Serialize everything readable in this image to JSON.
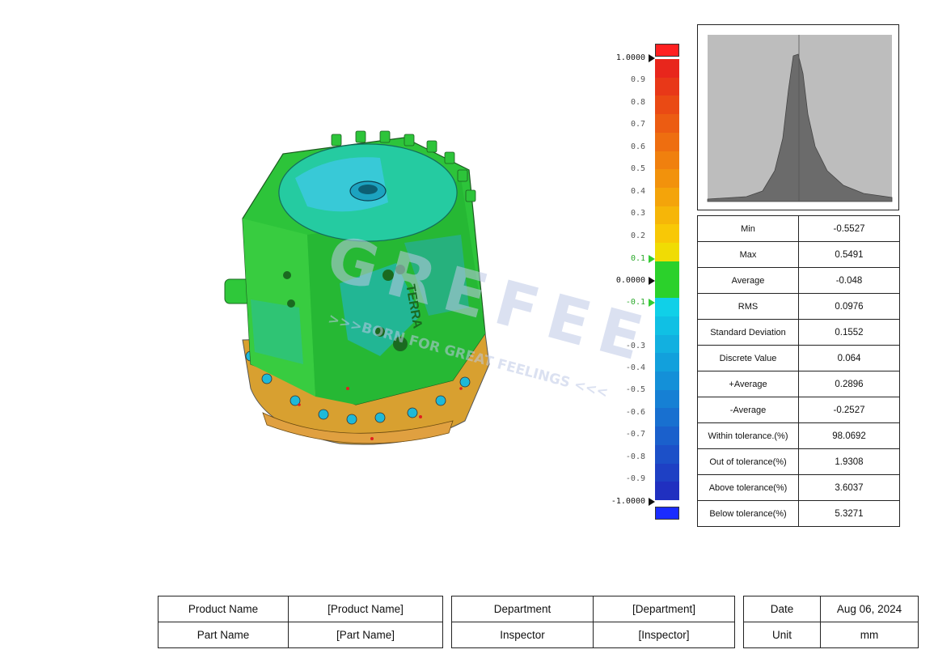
{
  "scale": {
    "ticks": [
      {
        "label": "1.0000",
        "kind": "major"
      },
      {
        "label": "0.9",
        "kind": "minor"
      },
      {
        "label": "0.8",
        "kind": "minor"
      },
      {
        "label": "0.7",
        "kind": "minor"
      },
      {
        "label": "0.6",
        "kind": "minor"
      },
      {
        "label": "0.5",
        "kind": "minor"
      },
      {
        "label": "0.4",
        "kind": "minor"
      },
      {
        "label": "0.3",
        "kind": "minor"
      },
      {
        "label": "0.2",
        "kind": "minor"
      },
      {
        "label": "0.1",
        "kind": "green"
      },
      {
        "label": "0.0000",
        "kind": "major"
      },
      {
        "label": "-0.1",
        "kind": "green"
      },
      {
        "label": "-0.3",
        "kind": "minor"
      },
      {
        "label": "-0.4",
        "kind": "minor"
      },
      {
        "label": "-0.5",
        "kind": "minor"
      },
      {
        "label": "-0.6",
        "kind": "minor"
      },
      {
        "label": "-0.7",
        "kind": "minor"
      },
      {
        "label": "-0.8",
        "kind": "minor"
      },
      {
        "label": "-0.9",
        "kind": "minor"
      },
      {
        "label": "-1.0000",
        "kind": "major"
      }
    ],
    "colors": [
      "#e8261c",
      "#e83818",
      "#ea4a14",
      "#ec5c12",
      "#ee6e10",
      "#f0800e",
      "#f2920c",
      "#f4a40a",
      "#f6b608",
      "#f8c806",
      "#f0dc04",
      "#2bd12b",
      "#2bd12b",
      "#10d0e8",
      "#10c0e4",
      "#12b0e0",
      "#12a0dc",
      "#1490d8",
      "#1680d4",
      "#1870d0",
      "#1a60cc",
      "#1c50c8",
      "#1e40c4",
      "#2030c0"
    ],
    "out_above_color": "#ff2020",
    "out_below_color": "#1a2cff",
    "tolerance_color": "#2bd12b"
  },
  "stats": [
    {
      "label": "Min",
      "value": "-0.5527"
    },
    {
      "label": "Max",
      "value": "0.5491"
    },
    {
      "label": "Average",
      "value": "-0.048"
    },
    {
      "label": "RMS",
      "value": "0.0976"
    },
    {
      "label": "Standard Deviation",
      "value": "0.1552"
    },
    {
      "label": "Discrete Value",
      "value": "0.064"
    },
    {
      "label": "+Average",
      "value": "0.2896"
    },
    {
      "label": "-Average",
      "value": "-0.2527"
    },
    {
      "label": "Within tolerance.(%)",
      "value": "98.0692"
    },
    {
      "label": "Out of tolerance(%)",
      "value": "1.9308"
    },
    {
      "label": "Above tolerance(%)",
      "value": "3.6037"
    },
    {
      "label": "Below tolerance(%)",
      "value": "5.3271"
    }
  ],
  "footer": {
    "product_name_label": "Product Name",
    "product_name_value": "[Product Name]",
    "part_name_label": "Part Name",
    "part_name_value": "[Part Name]",
    "department_label": "Department",
    "department_value": "[Department]",
    "inspector_label": "Inspector",
    "inspector_value": "[Inspector]",
    "date_label": "Date",
    "date_value": "Aug 06, 2024",
    "unit_label": "Unit",
    "unit_value": "mm"
  },
  "watermark": {
    "brand": "GREFEE",
    "tagline": ">>>BORN FOR GREAT FEELINGS <<<",
    "part_marking": "TERRA"
  }
}
